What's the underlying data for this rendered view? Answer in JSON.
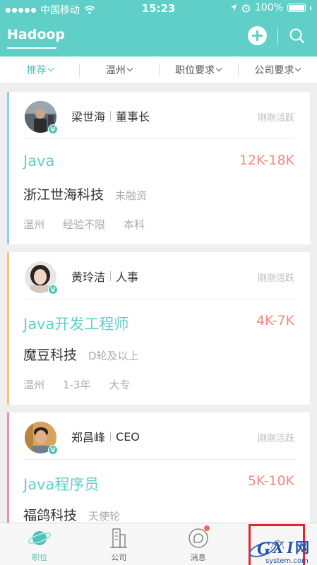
{
  "status_bar": {
    "carrier": "中国移动",
    "time": "15:23",
    "battery": "100%"
  },
  "nav": {
    "title": "Hadoop"
  },
  "filters": [
    "推荐",
    "温州",
    "职位要求",
    "公司要求"
  ],
  "jobs": [
    {
      "recruiter_name": "梁世海",
      "recruiter_role": "董事长",
      "active": "刚刚活跃",
      "title": "Java",
      "salary": "12K-18K",
      "company": "浙江世海科技",
      "stage": "未融资",
      "city": "温州",
      "experience": "经验不限",
      "education": "本科",
      "accent_color": "#8fd0f0"
    },
    {
      "recruiter_name": "黄玲洁",
      "recruiter_role": "人事",
      "active": "刚刚活跃",
      "title": "Java开发工程师",
      "salary": "4K-7K",
      "company": "魔豆科技",
      "stage": "D轮及以上",
      "city": "温州",
      "experience": "1-3年",
      "education": "大专",
      "accent_color": "#f5c66b"
    },
    {
      "recruiter_name": "郑昌峰",
      "recruiter_role": "CEO",
      "active": "刚刚活跃",
      "title": "Java程序员",
      "salary": "5K-10K",
      "company": "福鸽科技",
      "stage": "天使轮",
      "city": "",
      "experience": "",
      "education": "",
      "accent_color": "#f28fb0"
    }
  ],
  "tabs": [
    {
      "label": "职位",
      "icon": "planet-icon"
    },
    {
      "label": "公司",
      "icon": "building-icon"
    },
    {
      "label": "消息",
      "icon": "chat-icon"
    },
    {
      "label": "",
      "icon": "profile-icon"
    }
  ],
  "watermark": {
    "brand": "GXI网",
    "domain": "system.com"
  },
  "colors": {
    "primary": "#5fcfc7",
    "salary": "#f08b7f",
    "highlight": "#e8232a"
  }
}
